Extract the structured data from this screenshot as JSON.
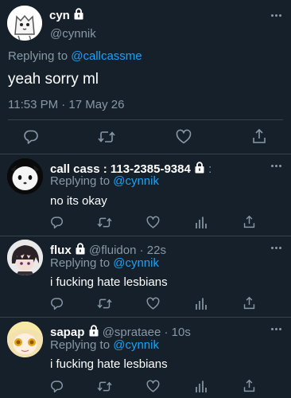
{
  "main_tweet": {
    "display_name": "cyn",
    "handle": "@cynnik",
    "replying_prefix": "Replying to",
    "replying_handle": "@callcassme",
    "text": "yeah sorry ml",
    "timestamp": "11:53 PM · 17 May 26"
  },
  "replies": [
    {
      "display_name": "call cass : 113-2385-9384",
      "handle": "",
      "time": "",
      "replying_prefix": "Replying to",
      "replying_handle": "@cynnik",
      "text": "no its okay"
    },
    {
      "display_name": "flux",
      "handle": "@fluidon",
      "time": "· 22s",
      "replying_prefix": "Replying to",
      "replying_handle": "@cynnik",
      "text": "i fucking hate lesbians"
    },
    {
      "display_name": "sapap",
      "handle": "@sprataee",
      "time": "· 10s",
      "replying_prefix": "Replying to",
      "replying_handle": "@cynnik",
      "text": "i fucking hate lesbians"
    }
  ],
  "colors": {
    "background": "#15202b",
    "text": "#ffffff",
    "secondary": "#8899a6",
    "link": "#1da1f2",
    "divider": "#38444d"
  },
  "icons": [
    "more-icon",
    "lock-icon",
    "reply-icon",
    "retweet-icon",
    "like-icon",
    "analytics-icon",
    "share-icon"
  ]
}
